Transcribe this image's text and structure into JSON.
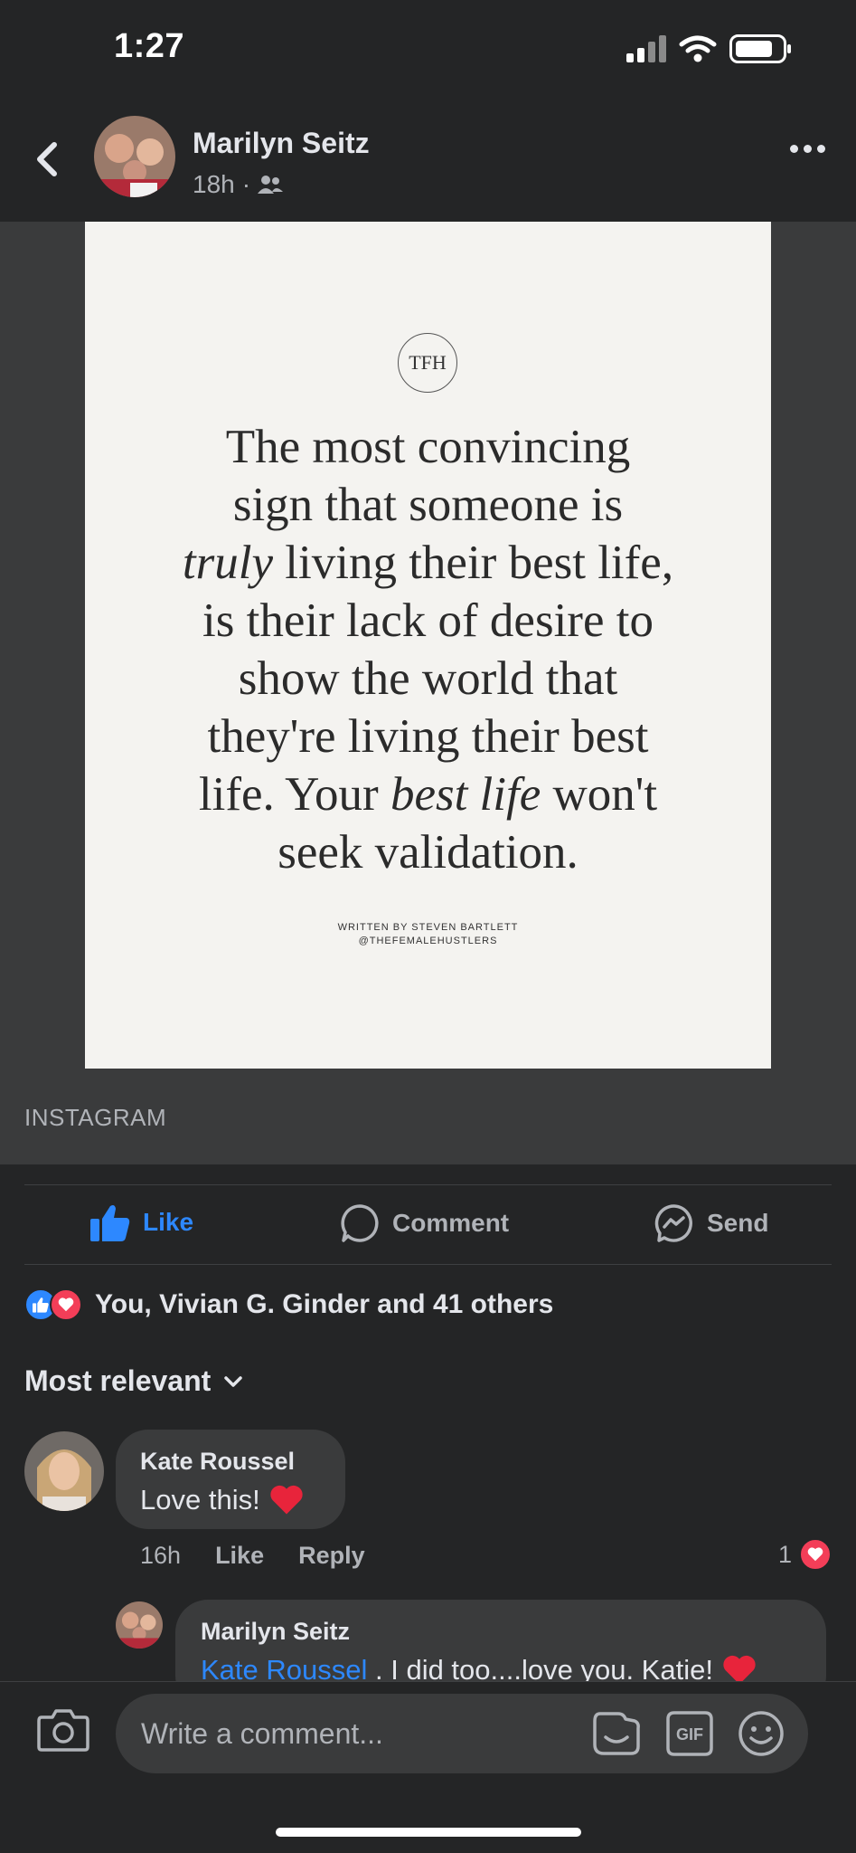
{
  "status_bar": {
    "time": "1:27"
  },
  "post": {
    "author": "Marilyn Seitz",
    "time": "18h",
    "separator": "·",
    "logo_mark": "TFH",
    "quote_lines": [
      "The most convincing",
      "sign that someone is",
      {
        "italic": "truly",
        "rest": " living their best life,"
      },
      "is their lack of desire to",
      "show the world that",
      "they're living their best",
      {
        "pre": "life. Your ",
        "italic": "best life",
        "rest": " won't"
      },
      "seek validation."
    ],
    "credit_line1": "WRITTEN BY STEVEN BARTLETT",
    "credit_line2": "@THEFEMALEHUSTLERS",
    "link_source": "INSTAGRAM"
  },
  "actions": {
    "like": "Like",
    "comment": "Comment",
    "send": "Send"
  },
  "reactions": {
    "summary": "You, Vivian G. Ginder and 41 others"
  },
  "comments_header": {
    "sort_label": "Most relevant"
  },
  "comments": [
    {
      "author": "Kate Roussel",
      "text": "Love this!",
      "time": "16h",
      "like_label": "Like",
      "reply_label": "Reply",
      "reaction_count": "1"
    }
  ],
  "reply": {
    "author": "Marilyn Seitz",
    "mention": "Kate Roussel",
    "text": " . I did too....love you. Katie!"
  },
  "composer": {
    "placeholder": "Write a comment...",
    "gif_label": "GIF"
  },
  "colors": {
    "accent": "#2d88ff",
    "love": "#f33e58",
    "background": "#242526",
    "surface": "#3a3b3c"
  }
}
